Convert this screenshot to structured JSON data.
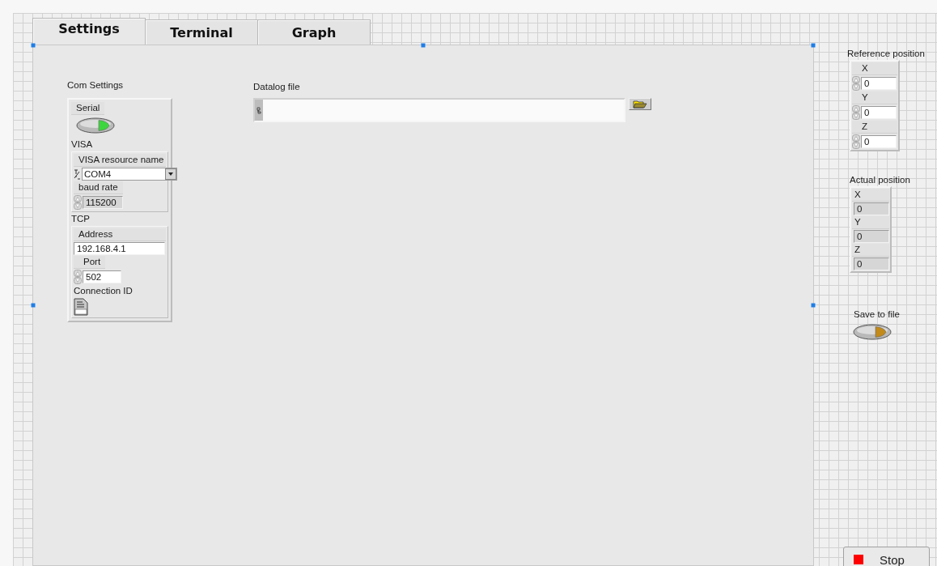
{
  "tabs": [
    {
      "label": "Settings",
      "selected": true
    },
    {
      "label": "Terminal",
      "selected": false
    },
    {
      "label": "Graph",
      "selected": false
    }
  ],
  "com_settings": {
    "label": "Com Settings",
    "serial": {
      "label": "Serial",
      "on": true
    },
    "visa": {
      "label": "VISA",
      "resource": {
        "label": "VISA resource name",
        "value": "COM4"
      },
      "baud_rate": {
        "label": "baud rate",
        "value": "115200"
      }
    },
    "tcp": {
      "label": "TCP",
      "address": {
        "label": "Address",
        "value": "192.168.4.1"
      },
      "port": {
        "label": "Port",
        "value": "502"
      },
      "connection_id": {
        "label": "Connection ID"
      }
    }
  },
  "datalog_file": {
    "label": "Datalog file"
  },
  "reference_position": {
    "label": "Reference position",
    "fields": [
      {
        "label": "X",
        "value": "0"
      },
      {
        "label": "Y",
        "value": "0"
      },
      {
        "label": "Z",
        "value": "0"
      }
    ]
  },
  "actual_position": {
    "label": "Actual position",
    "fields": [
      {
        "label": "X",
        "value": "0"
      },
      {
        "label": "Y",
        "value": "0"
      },
      {
        "label": "Z",
        "value": "0"
      }
    ]
  },
  "save_to_file": {
    "label": "Save to file",
    "on": false
  },
  "stop_button": {
    "label": "Stop"
  }
}
